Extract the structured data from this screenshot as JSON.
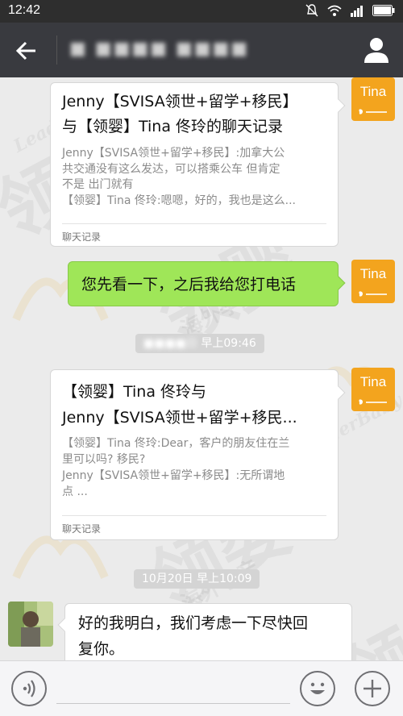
{
  "status": {
    "time": "12:42"
  },
  "nav": {
    "contact_name": "■ ■■■■ ■■■■"
  },
  "messages": {
    "card1": {
      "title_line1": "Jenny【SVISA领世+留学+移民】",
      "title_line2": "与【领婴】Tina 佟玲的聊天记录",
      "body_line1": "Jenny【SVISA领世+留学+移民】:加拿大公",
      "body_line2": "共交通没有这么发达，可以搭乘公车 但肯定",
      "body_line3": "不是 出门就有",
      "body_line4": "【领婴】Tina 佟玲:嗯嗯，好的，我也是这么...",
      "footer": "聊天记录"
    },
    "green_msg": "您先看一下，之后我给您打电话",
    "time1": {
      "blurred": "■■■■日",
      "time": "早上09:46"
    },
    "card2": {
      "title_line1": "【领婴】Tina 佟玲与",
      "title_line2": "Jenny【SVISA领世+留学+移民...",
      "body_line1": "【领婴】Tina 佟玲:Dear，客户的朋友住在兰",
      "body_line2": "里可以吗? 移民?",
      "body_line3": "Jenny【SVISA领世+留学+移民】:无所谓地",
      "body_line4": "点 ...",
      "footer": "聊天记录"
    },
    "time2": "10月20日 早上10:09",
    "white_msg_line1": "好的我明白，我们考虑一下尽快回",
    "white_msg_line2": "复你。"
  },
  "avatar": {
    "label": "Tina"
  },
  "watermark": {
    "big": "领婴",
    "small": "海外孕产",
    "latin": "LeaderBaby"
  }
}
